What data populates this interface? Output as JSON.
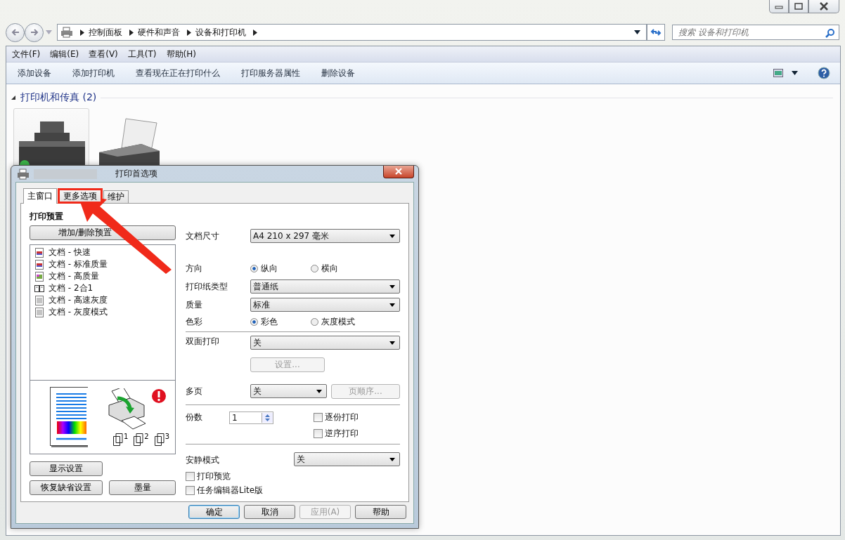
{
  "address_bar": {
    "breadcrumbs": [
      "控制面板",
      "硬件和声音",
      "设备和打印机"
    ]
  },
  "search": {
    "placeholder": "搜索 设备和打印机"
  },
  "menu": [
    "文件(F)",
    "编辑(E)",
    "查看(V)",
    "工具(T)",
    "帮助(H)"
  ],
  "toolbar": [
    "添加设备",
    "添加打印机",
    "查看现在正在打印什么",
    "打印服务器属性",
    "删除设备"
  ],
  "group": {
    "title": "打印机和传真 (2)",
    "expanded": true
  },
  "devices": [
    {
      "kind": "inkjet",
      "selected": true,
      "default": true
    },
    {
      "kind": "laser",
      "selected": false,
      "default": false
    }
  ],
  "dialog": {
    "title": "打印首选项",
    "tabs": [
      {
        "label": "主窗口",
        "selected": true,
        "highlighted": false
      },
      {
        "label": "更多选项",
        "selected": false,
        "highlighted": true
      },
      {
        "label": "维护",
        "selected": false,
        "highlighted": false
      }
    ],
    "presets_title": "打印预置",
    "presets_button": "增加/删除预置",
    "presets": [
      {
        "kind": "color",
        "label": "文档 - 快速"
      },
      {
        "kind": "color",
        "label": "文档 - 标准质量"
      },
      {
        "kind": "photo",
        "label": "文档 - 高质量"
      },
      {
        "kind": "nup",
        "label": "文档 - 2合1"
      },
      {
        "kind": "gray",
        "label": "文档 - 高速灰度"
      },
      {
        "kind": "gray",
        "label": "文档 - 灰度模式"
      }
    ],
    "collate_pages": [
      "1",
      "2",
      "3"
    ],
    "left_buttons": [
      "显示设置",
      "恢复缺省设置",
      "墨量"
    ],
    "settings": [
      {
        "kind": "select",
        "label": "文档尺寸",
        "value": "A4 210 x 297 毫米"
      },
      {
        "kind": "radio",
        "label": "方向",
        "options": [
          {
            "label": "纵向",
            "selected": true
          },
          {
            "label": "横向",
            "selected": false
          }
        ]
      },
      {
        "kind": "select",
        "label": "打印纸类型",
        "value": "普通纸"
      },
      {
        "kind": "select",
        "label": "质量",
        "value": "标准"
      },
      {
        "kind": "radio",
        "label": "色彩",
        "options": [
          {
            "label": "彩色",
            "selected": true
          },
          {
            "label": "灰度模式",
            "selected": false
          }
        ]
      },
      {
        "kind": "divider"
      },
      {
        "kind": "select",
        "label": "双面打印",
        "value": "关"
      },
      {
        "kind": "button",
        "label": "设置...",
        "disabled": true
      },
      {
        "kind": "select_button",
        "label": "多页",
        "value": "关",
        "button": "页顺序...",
        "disabled": true
      },
      {
        "kind": "divider"
      },
      {
        "kind": "copies",
        "label": "份数",
        "value": "1",
        "checks": [
          {
            "label": "逐份打印",
            "checked": false
          },
          {
            "label": "逆序打印",
            "checked": false
          }
        ]
      },
      {
        "kind": "divider"
      },
      {
        "kind": "select_wide",
        "label": "安静模式",
        "value": "关"
      },
      {
        "kind": "check",
        "label": "打印预览",
        "checked": false
      },
      {
        "kind": "check",
        "label": "任务编辑器Lite版",
        "checked": false
      }
    ],
    "footer_buttons": [
      {
        "label": "确定",
        "default": true,
        "disabled": false
      },
      {
        "label": "取消",
        "default": false,
        "disabled": false
      },
      {
        "label": "应用(A)",
        "default": false,
        "disabled": true
      },
      {
        "label": "帮助",
        "default": false,
        "disabled": false
      }
    ]
  }
}
